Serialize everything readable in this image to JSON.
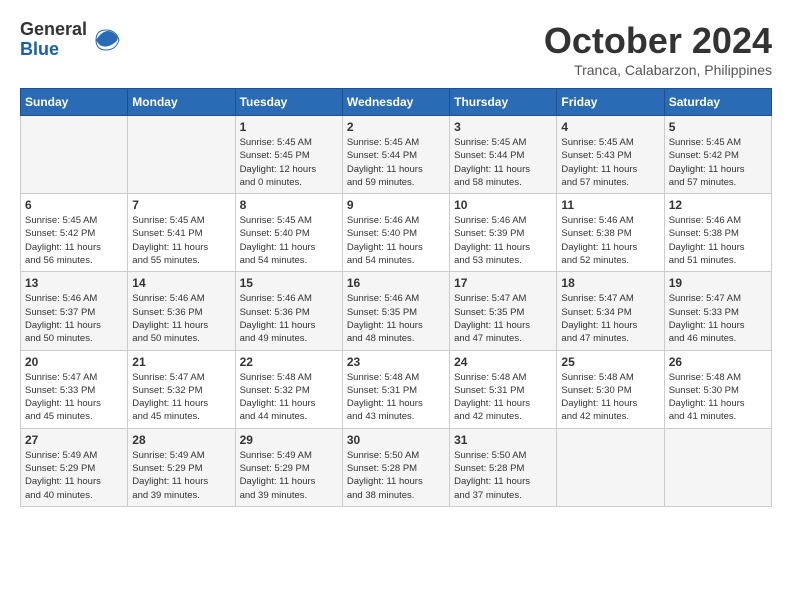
{
  "logo": {
    "general": "General",
    "blue": "Blue"
  },
  "title": "October 2024",
  "location": "Tranca, Calabarzon, Philippines",
  "headers": [
    "Sunday",
    "Monday",
    "Tuesday",
    "Wednesday",
    "Thursday",
    "Friday",
    "Saturday"
  ],
  "weeks": [
    [
      {
        "day": "",
        "info": ""
      },
      {
        "day": "",
        "info": ""
      },
      {
        "day": "1",
        "info": "Sunrise: 5:45 AM\nSunset: 5:45 PM\nDaylight: 12 hours\nand 0 minutes."
      },
      {
        "day": "2",
        "info": "Sunrise: 5:45 AM\nSunset: 5:44 PM\nDaylight: 11 hours\nand 59 minutes."
      },
      {
        "day": "3",
        "info": "Sunrise: 5:45 AM\nSunset: 5:44 PM\nDaylight: 11 hours\nand 58 minutes."
      },
      {
        "day": "4",
        "info": "Sunrise: 5:45 AM\nSunset: 5:43 PM\nDaylight: 11 hours\nand 57 minutes."
      },
      {
        "day": "5",
        "info": "Sunrise: 5:45 AM\nSunset: 5:42 PM\nDaylight: 11 hours\nand 57 minutes."
      }
    ],
    [
      {
        "day": "6",
        "info": "Sunrise: 5:45 AM\nSunset: 5:42 PM\nDaylight: 11 hours\nand 56 minutes."
      },
      {
        "day": "7",
        "info": "Sunrise: 5:45 AM\nSunset: 5:41 PM\nDaylight: 11 hours\nand 55 minutes."
      },
      {
        "day": "8",
        "info": "Sunrise: 5:45 AM\nSunset: 5:40 PM\nDaylight: 11 hours\nand 54 minutes."
      },
      {
        "day": "9",
        "info": "Sunrise: 5:46 AM\nSunset: 5:40 PM\nDaylight: 11 hours\nand 54 minutes."
      },
      {
        "day": "10",
        "info": "Sunrise: 5:46 AM\nSunset: 5:39 PM\nDaylight: 11 hours\nand 53 minutes."
      },
      {
        "day": "11",
        "info": "Sunrise: 5:46 AM\nSunset: 5:38 PM\nDaylight: 11 hours\nand 52 minutes."
      },
      {
        "day": "12",
        "info": "Sunrise: 5:46 AM\nSunset: 5:38 PM\nDaylight: 11 hours\nand 51 minutes."
      }
    ],
    [
      {
        "day": "13",
        "info": "Sunrise: 5:46 AM\nSunset: 5:37 PM\nDaylight: 11 hours\nand 50 minutes."
      },
      {
        "day": "14",
        "info": "Sunrise: 5:46 AM\nSunset: 5:36 PM\nDaylight: 11 hours\nand 50 minutes."
      },
      {
        "day": "15",
        "info": "Sunrise: 5:46 AM\nSunset: 5:36 PM\nDaylight: 11 hours\nand 49 minutes."
      },
      {
        "day": "16",
        "info": "Sunrise: 5:46 AM\nSunset: 5:35 PM\nDaylight: 11 hours\nand 48 minutes."
      },
      {
        "day": "17",
        "info": "Sunrise: 5:47 AM\nSunset: 5:35 PM\nDaylight: 11 hours\nand 47 minutes."
      },
      {
        "day": "18",
        "info": "Sunrise: 5:47 AM\nSunset: 5:34 PM\nDaylight: 11 hours\nand 47 minutes."
      },
      {
        "day": "19",
        "info": "Sunrise: 5:47 AM\nSunset: 5:33 PM\nDaylight: 11 hours\nand 46 minutes."
      }
    ],
    [
      {
        "day": "20",
        "info": "Sunrise: 5:47 AM\nSunset: 5:33 PM\nDaylight: 11 hours\nand 45 minutes."
      },
      {
        "day": "21",
        "info": "Sunrise: 5:47 AM\nSunset: 5:32 PM\nDaylight: 11 hours\nand 45 minutes."
      },
      {
        "day": "22",
        "info": "Sunrise: 5:48 AM\nSunset: 5:32 PM\nDaylight: 11 hours\nand 44 minutes."
      },
      {
        "day": "23",
        "info": "Sunrise: 5:48 AM\nSunset: 5:31 PM\nDaylight: 11 hours\nand 43 minutes."
      },
      {
        "day": "24",
        "info": "Sunrise: 5:48 AM\nSunset: 5:31 PM\nDaylight: 11 hours\nand 42 minutes."
      },
      {
        "day": "25",
        "info": "Sunrise: 5:48 AM\nSunset: 5:30 PM\nDaylight: 11 hours\nand 42 minutes."
      },
      {
        "day": "26",
        "info": "Sunrise: 5:48 AM\nSunset: 5:30 PM\nDaylight: 11 hours\nand 41 minutes."
      }
    ],
    [
      {
        "day": "27",
        "info": "Sunrise: 5:49 AM\nSunset: 5:29 PM\nDaylight: 11 hours\nand 40 minutes."
      },
      {
        "day": "28",
        "info": "Sunrise: 5:49 AM\nSunset: 5:29 PM\nDaylight: 11 hours\nand 39 minutes."
      },
      {
        "day": "29",
        "info": "Sunrise: 5:49 AM\nSunset: 5:29 PM\nDaylight: 11 hours\nand 39 minutes."
      },
      {
        "day": "30",
        "info": "Sunrise: 5:50 AM\nSunset: 5:28 PM\nDaylight: 11 hours\nand 38 minutes."
      },
      {
        "day": "31",
        "info": "Sunrise: 5:50 AM\nSunset: 5:28 PM\nDaylight: 11 hours\nand 37 minutes."
      },
      {
        "day": "",
        "info": ""
      },
      {
        "day": "",
        "info": ""
      }
    ]
  ]
}
